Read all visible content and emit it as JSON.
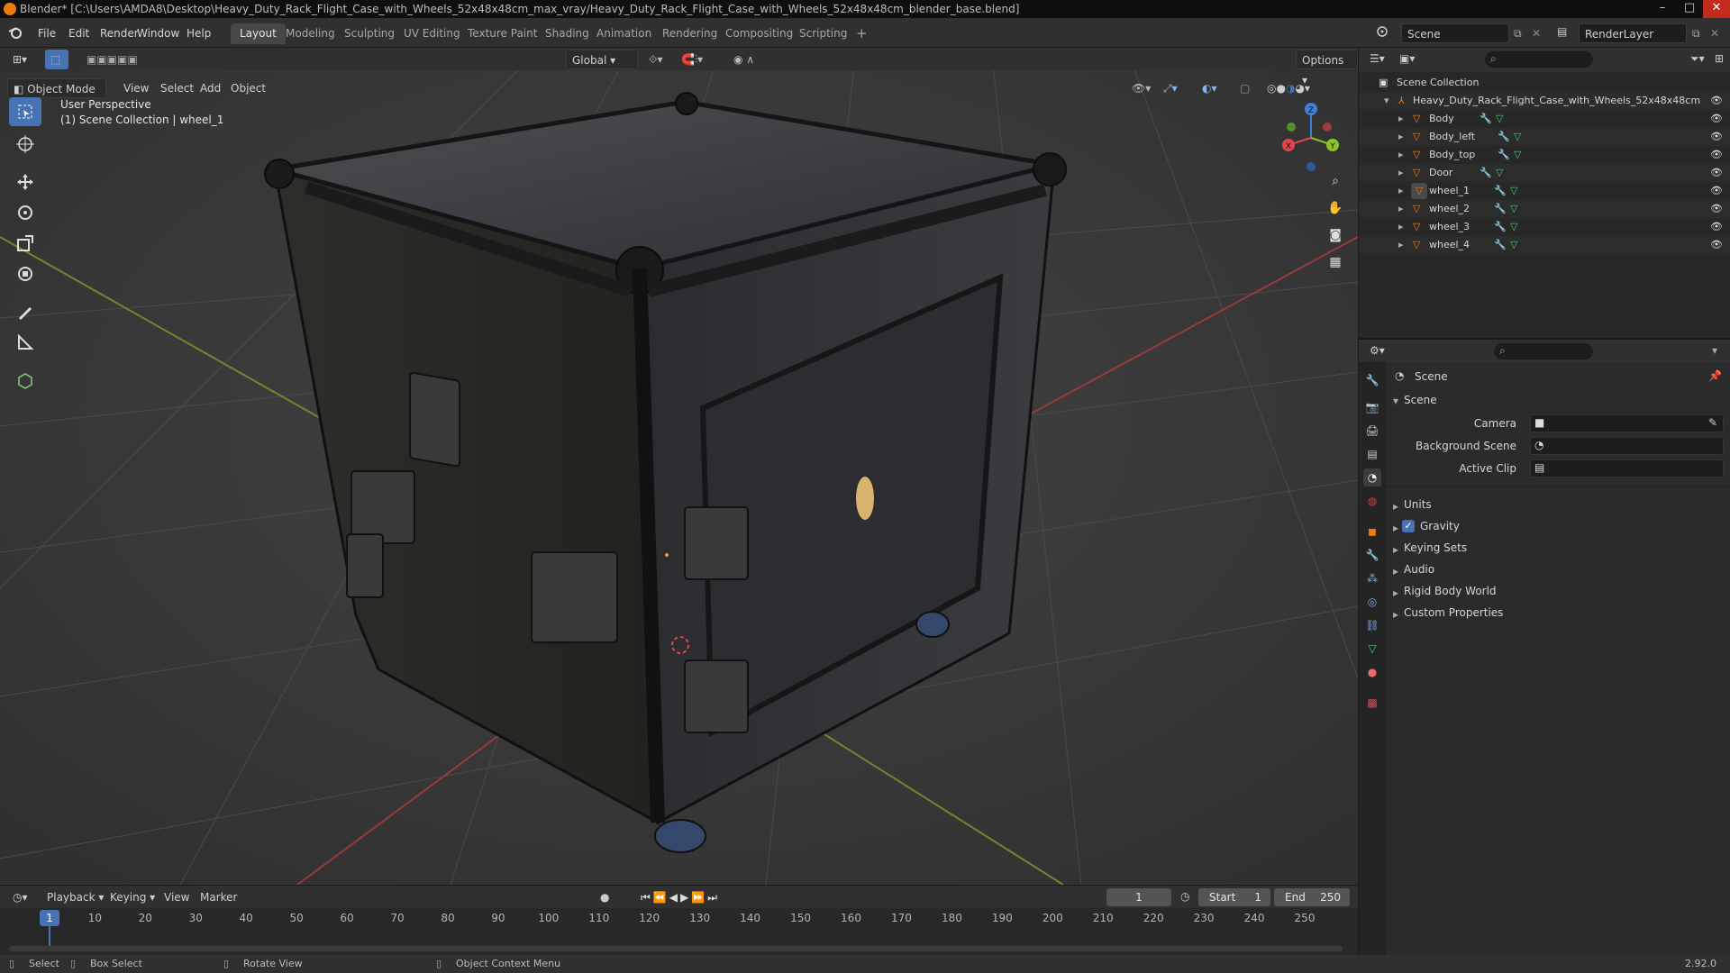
{
  "window": {
    "title": "Blender* [C:\\Users\\AMDA8\\Desktop\\Heavy_Duty_Rack_Flight_Case_with_Wheels_52x48x48cm_max_vray/Heavy_Duty_Rack_Flight_Case_with_Wheels_52x48x48cm_blender_base.blend]",
    "min": "–",
    "max": "□",
    "close": "✕"
  },
  "menu": [
    "File",
    "Edit",
    "Render",
    "Window",
    "Help"
  ],
  "workspaces": [
    "Layout",
    "Modeling",
    "Sculpting",
    "UV Editing",
    "Texture Paint",
    "Shading",
    "Animation",
    "Rendering",
    "Compositing",
    "Scripting",
    "+"
  ],
  "scene_name": "Scene",
  "view_layer": "RenderLayer",
  "viewport": {
    "mode": "Object Mode",
    "menus": [
      "View",
      "Select",
      "Add",
      "Object"
    ],
    "orientation": "Global",
    "options": "Options",
    "overlay_title": "User Perspective",
    "overlay_sub": "(1) Scene Collection | wheel_1",
    "gizmo": {
      "x": "X",
      "y": "Y",
      "z": "Z"
    }
  },
  "outliner": {
    "root": "Scene Collection",
    "collection": "Heavy_Duty_Rack_Flight_Case_with_Wheels_52x48x48cm",
    "objects": [
      "Body",
      "Body_left",
      "Body_top",
      "Door",
      "wheel_1",
      "wheel_2",
      "wheel_3",
      "wheel_4"
    ]
  },
  "properties": {
    "context": "Scene",
    "panel": "Scene",
    "fields": [
      {
        "label": "Camera"
      },
      {
        "label": "Background Scene"
      },
      {
        "label": "Active Clip"
      }
    ],
    "subpanels": [
      "Units",
      "Gravity",
      "Keying Sets",
      "Audio",
      "Rigid Body World",
      "Custom Properties"
    ],
    "gravity_checked": true
  },
  "timeline": {
    "menus": [
      "Playback",
      "Keying",
      "View",
      "Marker"
    ],
    "current_frame": "1",
    "start_label": "Start",
    "start": "1",
    "end_label": "End",
    "end": "250",
    "ticks": [
      "1",
      "10",
      "20",
      "30",
      "40",
      "50",
      "60",
      "70",
      "80",
      "90",
      "100",
      "110",
      "120",
      "130",
      "140",
      "150",
      "160",
      "170",
      "180",
      "190",
      "200",
      "210",
      "220",
      "230",
      "240",
      "250"
    ]
  },
  "status": {
    "select": "Select",
    "box_select": "Box Select",
    "rotate": "Rotate View",
    "context_menu": "Object Context Menu",
    "version": "2.92.0"
  },
  "colors": {
    "accent": "#4772b3",
    "orange": "#e87d0d",
    "axis_x": "#e2464a",
    "axis_y": "#8ac427",
    "axis_z": "#3d7fdd"
  }
}
